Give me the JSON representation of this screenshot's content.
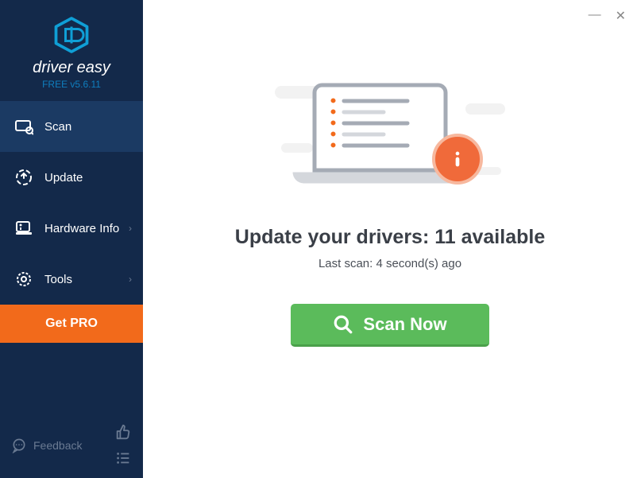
{
  "brand": {
    "name": "driver easy",
    "version": "FREE v5.6.11"
  },
  "sidebar": {
    "items": [
      {
        "label": "Scan",
        "icon": "scan-icon",
        "expandable": false
      },
      {
        "label": "Update",
        "icon": "update-icon",
        "expandable": false
      },
      {
        "label": "Hardware Info",
        "icon": "hardware-info-icon",
        "expandable": true
      },
      {
        "label": "Tools",
        "icon": "tools-icon",
        "expandable": true
      }
    ],
    "get_pro_label": "Get PRO",
    "feedback_label": "Feedback"
  },
  "main": {
    "headline": "Update your drivers: 11 available",
    "subline": "Last scan: 4 second(s) ago",
    "scan_button_label": "Scan Now",
    "info_badge": "i"
  },
  "colors": {
    "sidebar_bg": "#13294a",
    "sidebar_active": "#1b3a63",
    "accent_orange": "#f26a1b",
    "accent_green": "#5bbb5b"
  }
}
